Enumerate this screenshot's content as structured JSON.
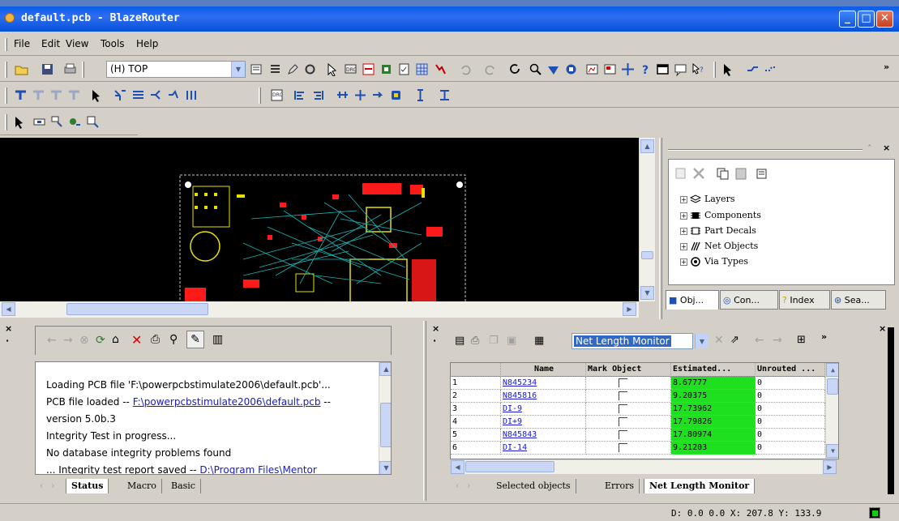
{
  "window": {
    "title": "default.pcb - BlazeRouter"
  },
  "menu": {
    "items": [
      "File",
      "Edit",
      "View",
      "Tools",
      "Help"
    ]
  },
  "toolbar": {
    "layer_value": "(H) TOP",
    "overflow": "»"
  },
  "objects_panel": {
    "tree": [
      "Layers",
      "Components",
      "Part Decals",
      "Net Objects",
      "Via Types"
    ],
    "tabs": [
      "Obj...",
      "Con...",
      "Index",
      "Sea..."
    ]
  },
  "status_panel": {
    "log": [
      {
        "text": "Loading PCB file 'F:\\powerpcbstimulate2006\\default.pcb'..."
      },
      {
        "prefix": "PCB file loaded -- ",
        "link": "F:\\powerpcbstimulate2006\\default.pcb",
        "suffix": " --"
      },
      {
        "text": "version 5.0b.3"
      },
      {
        "text": "Integrity Test  in progress..."
      },
      {
        "text": "No database integrity problems found"
      },
      {
        "prefix": "... Integrity test report saved -- ",
        "path": "D:\\Program Files\\Mentor"
      }
    ],
    "tabs": [
      "Status",
      "Macro",
      "Basic"
    ],
    "active_tab": "Status"
  },
  "net_panel": {
    "view_select": "Net Length Monitor",
    "columns": [
      "Name",
      "Mark Object",
      "Estimated...",
      "Unrouted ..."
    ],
    "rows": [
      {
        "index": "1",
        "name": "N845234",
        "estimated": "8.67777",
        "unrouted": "0"
      },
      {
        "index": "2",
        "name": "N845816",
        "estimated": "9.20375",
        "unrouted": "0"
      },
      {
        "index": "3",
        "name": "DI-9",
        "estimated": "17.73962",
        "unrouted": "0"
      },
      {
        "index": "4",
        "name": "DI+9",
        "estimated": "17.79826",
        "unrouted": "0"
      },
      {
        "index": "5",
        "name": "N845843",
        "estimated": "17.80974",
        "unrouted": "0"
      },
      {
        "index": "6",
        "name": "DI-14",
        "estimated": "9.21203",
        "unrouted": "0"
      }
    ],
    "tabs": [
      "Selected objects",
      "Errors",
      "Net Length Monitor"
    ],
    "active_tab": "Net Length Monitor",
    "overflow": "»"
  },
  "statusbar": {
    "coords": "D: 0.0 0.0 X: 207.8  Y: 133.9"
  },
  "colors": {
    "title_blue": "#0a5ce8",
    "estimated_ok": "#1ee01e",
    "pcb_background": "#000000"
  }
}
